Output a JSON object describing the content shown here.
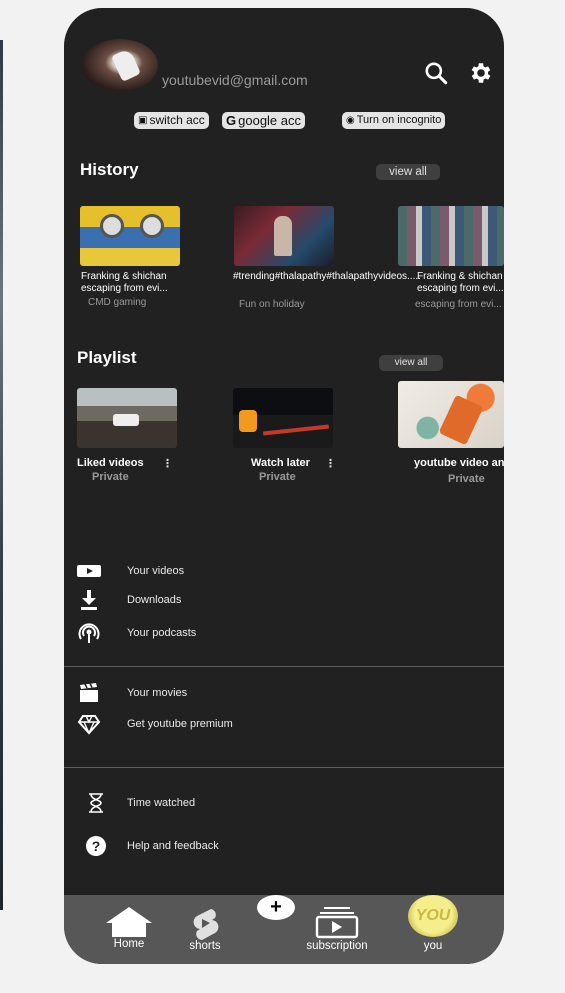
{
  "account": {
    "email": "youtubevid@gmail.com",
    "buttons": {
      "switch": "switch acc",
      "google": "google acc",
      "incognito": "Turn on incognito"
    }
  },
  "history": {
    "title": "History",
    "view_all": "view all",
    "items": [
      {
        "title": "Franking & shichan escaping from evi...",
        "channel": "CMD gaming"
      },
      {
        "title": "#trending#thalapathy#thalapathyvideos.....",
        "channel": "Fun on holiday"
      },
      {
        "title": "Franking & shichan escaping from evi...",
        "channel": "escaping from evi..."
      }
    ]
  },
  "playlist": {
    "title": "Playlist",
    "view_all": "view all",
    "items": [
      {
        "title": "Liked videos",
        "privacy": "Private"
      },
      {
        "title": "Watch later",
        "privacy": "Private"
      },
      {
        "title": "youtube video and",
        "privacy": "Private"
      }
    ]
  },
  "menu": {
    "your_videos": "Your videos",
    "downloads": "Downloads",
    "podcasts": "Your podcasts",
    "movies": "Your movies",
    "premium": "Get youtube premium",
    "time_watched": "Time watched",
    "help": "Help and feedback"
  },
  "bottom_nav": {
    "home": "Home",
    "shorts": "shorts",
    "create": "+",
    "subscription": "subscription",
    "you": "you",
    "you_avatar_text": "YOU"
  },
  "icons": {
    "search": "search-icon",
    "settings": "gear-icon"
  }
}
